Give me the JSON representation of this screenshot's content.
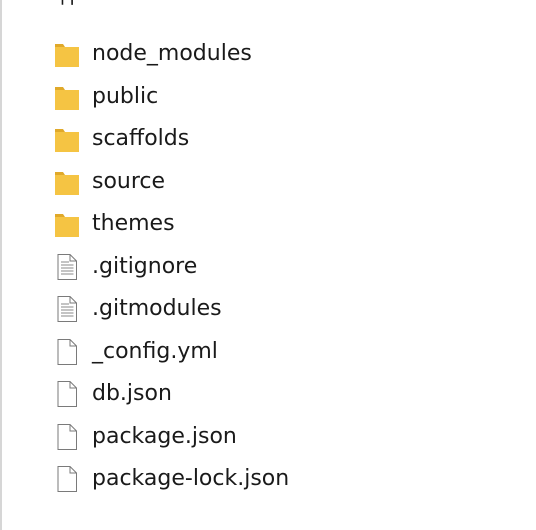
{
  "header_fragment": "件",
  "files": [
    {
      "name": "node_modules",
      "icon": "folder-icon"
    },
    {
      "name": "public",
      "icon": "folder-icon"
    },
    {
      "name": "scaffolds",
      "icon": "folder-icon"
    },
    {
      "name": "source",
      "icon": "folder-icon"
    },
    {
      "name": "themes",
      "icon": "folder-icon"
    },
    {
      "name": ".gitignore",
      "icon": "text-file-icon"
    },
    {
      "name": ".gitmodules",
      "icon": "text-file-icon"
    },
    {
      "name": "_config.yml",
      "icon": "blank-file-icon"
    },
    {
      "name": "db.json",
      "icon": "blank-file-icon"
    },
    {
      "name": "package.json",
      "icon": "blank-file-icon"
    },
    {
      "name": "package-lock.json",
      "icon": "blank-file-icon"
    }
  ],
  "colors": {
    "folder": "#f5c443",
    "folder_dark": "#e0a92a",
    "file_outline": "#7a7a7a"
  }
}
